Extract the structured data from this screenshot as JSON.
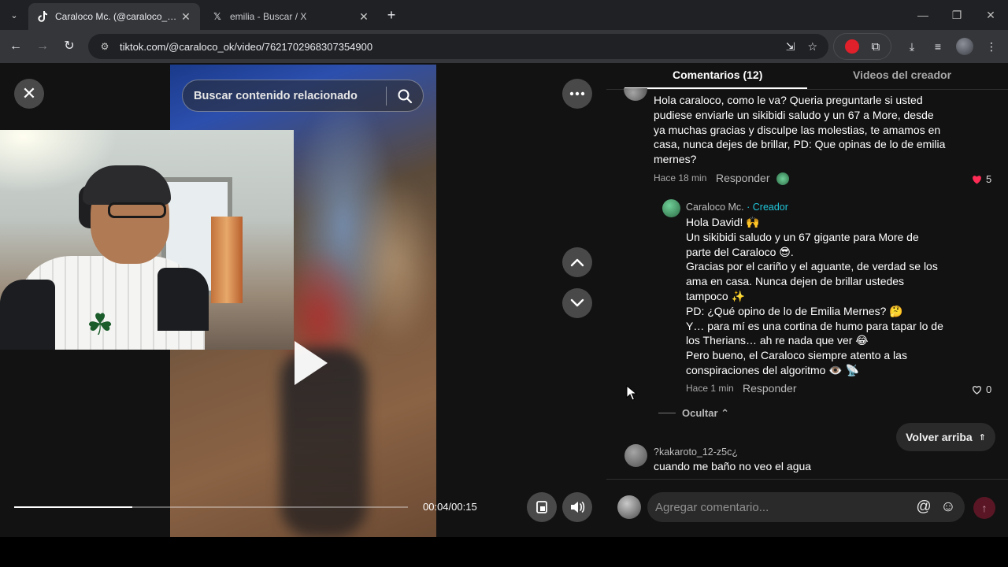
{
  "browser": {
    "tabs": [
      {
        "title": "Caraloco Mc. (@caraloco_ok) | T",
        "favicon": "tiktok-icon",
        "active": true
      },
      {
        "title": "emilia - Buscar / X",
        "favicon": "x-icon",
        "active": false
      }
    ],
    "url": "tiktok.com/@caraloco_ok/video/7621702968307354900"
  },
  "video": {
    "search_placeholder": "Buscar contenido relacionado",
    "time": "00:04/00:15",
    "progress": 0.3
  },
  "panel": {
    "tab_comments": "Comentarios (12)",
    "tab_creator_videos": "Videos del creador",
    "comment1": {
      "text": "Hola caraloco, como le va? Queria preguntarle si usted\npudiese enviarle un sikibidi saludo y un 67 a More, desde\nya muchas gracias y disculpe las molestias, te amamos en\ncasa, nunca dejes de brillar, PD: Que opinas de lo de emilia\nmernes?",
      "time": "Hace 18 min",
      "reply_label": "Responder",
      "likes": "5"
    },
    "reply1": {
      "user": "Caraloco Mc.",
      "badge": "· Creador",
      "text": "Hola David! 🙌\nUn sikibidi saludo y un 67 gigante para More de\nparte del Caraloco 😎.\nGracias por el cariño y el aguante, de verdad se los\nama en casa. Nunca dejen de brillar ustedes\ntampoco ✨\nPD: ¿Qué opino de lo de Emilia Mernes? 🤔\nY… para mí es una cortina de humo para tapar lo de\nlos Therians… ah re nada que ver 😂\nPero bueno, el Caraloco siempre atento a las\nconspiraciones del algoritmo 👁️ 📡",
      "time": "Hace 1 min",
      "reply_label": "Responder",
      "likes": "0"
    },
    "hide_label": "Ocultar",
    "back_to_top": "Volver arriba",
    "comment2": {
      "user": "?kakaroto_12-z5c¿",
      "text": "cuando me baño no veo el agua"
    },
    "input_placeholder": "Agregar comentario..."
  },
  "colors": {
    "accent_like": "#fe2c55",
    "creator_badge": "#20c5d9"
  }
}
